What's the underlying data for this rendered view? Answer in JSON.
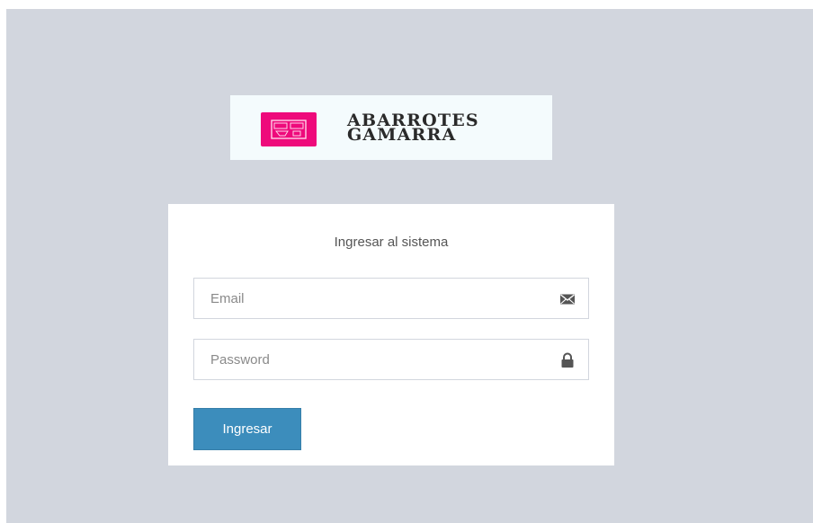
{
  "logo": {
    "line1": "ABARROTES",
    "line2": "GAMARRA",
    "badge_color": "#ee0a7b"
  },
  "login": {
    "message": "Ingresar al sistema",
    "email_placeholder": "Email",
    "email_icon": "envelope-icon",
    "password_placeholder": "Password",
    "password_icon": "lock-icon",
    "submit_label": "Ingresar",
    "button_color": "#3c8dbc"
  },
  "colors": {
    "background": "#d2d6de",
    "box": "#ffffff"
  }
}
